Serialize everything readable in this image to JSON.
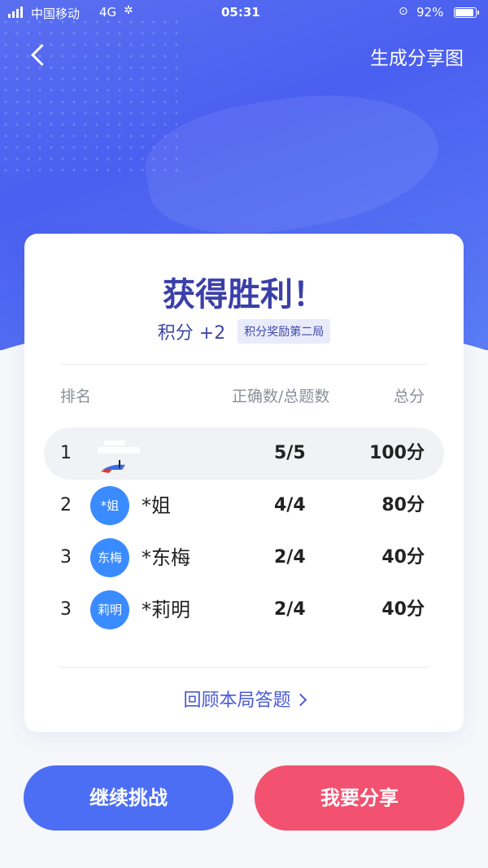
{
  "status_bar": {
    "carrier": "中国移动",
    "network": "4G",
    "time": "05:31",
    "battery": "92%"
  },
  "header": {
    "share_image_label": "生成分享图"
  },
  "result": {
    "title": "获得胜利！",
    "points": "积分 +2",
    "reward_tag": "积分奖励第二局"
  },
  "table": {
    "columns": {
      "rank": "排名",
      "correct": "正确数/总题数",
      "score": "总分"
    },
    "rows": [
      {
        "rank": "1",
        "avatar": "",
        "name": "",
        "correct": "5/5",
        "score": "100分"
      },
      {
        "rank": "2",
        "avatar": "*姐",
        "name": "*姐",
        "correct": "4/4",
        "score": "80分"
      },
      {
        "rank": "3",
        "avatar": "东梅",
        "name": "*东梅",
        "correct": "2/4",
        "score": "40分"
      },
      {
        "rank": "3",
        "avatar": "莉明",
        "name": "*莉明",
        "correct": "2/4",
        "score": "40分"
      }
    ]
  },
  "review_label": "回顾本局答题",
  "buttons": {
    "continue": "继续挑战",
    "share": "我要分享"
  },
  "colors": {
    "primary": "#4c6ef5",
    "share": "#f2516f",
    "title": "#3b3fa8",
    "avatar": "#3a8bff"
  }
}
